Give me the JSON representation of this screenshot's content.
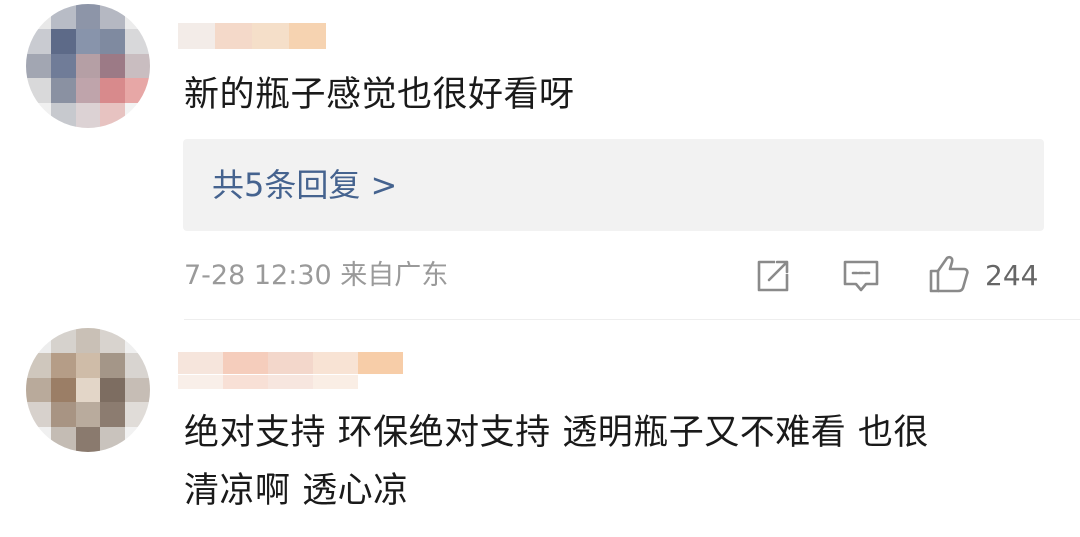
{
  "comments": [
    {
      "text": "新的瓶子感觉也很好看呀",
      "replies_label": "共5条回复 >",
      "timestamp": "7-28 12:30",
      "location": "来自广东",
      "like_count": "244",
      "avatar_colors": [
        "#e8e8e8",
        "#b8bcc6",
        "#8d95a8",
        "#b5b8c2",
        "#ececec",
        "#c9cbd1",
        "#5d6a88",
        "#8894ab",
        "#7f8aa0",
        "#d8d8da",
        "#a2a6b2",
        "#707c98",
        "#b59fa5",
        "#9c7a86",
        "#c9bdc0",
        "#d9d9da",
        "#8a91a2",
        "#bfa4ab",
        "#d88a8c",
        "#e7a7a6",
        "#f0f0f0",
        "#c7c9ce",
        "#dcd2d4",
        "#e7c3c1",
        "#f3f3f3"
      ],
      "name_colors": [
        "#f3ece8",
        "#f4d9c9",
        "#f5dfc9",
        "#f6d3b1"
      ]
    },
    {
      "text_line1": "绝对支持 环保绝对支持 透明瓶子又不难看 也很",
      "text_line2": "清凉啊 透心凉",
      "avatar_colors": [
        "#ededed",
        "#d6d2cd",
        "#c9c0b6",
        "#d8d3ce",
        "#efefef",
        "#cfc7bd",
        "#b59d87",
        "#cfbca8",
        "#a49688",
        "#d8d4d0",
        "#b9aa9b",
        "#9b7e66",
        "#e3d6c8",
        "#7d6d61",
        "#c6bdb5",
        "#d7d1cc",
        "#a89483",
        "#b9ab9d",
        "#8c7c70",
        "#e0dcd8",
        "#f0f0f0",
        "#c4bcb4",
        "#8a7a6e",
        "#c9c3bd",
        "#f2f2f2"
      ],
      "name_colors": [
        "#f6e5dc",
        "#f5cdbc",
        "#f3d7cb",
        "#f8e3d4",
        "#f7cda8"
      ]
    }
  ],
  "icons": {
    "share": "share-icon",
    "comment": "comment-icon",
    "like": "thumbs-up-icon"
  }
}
